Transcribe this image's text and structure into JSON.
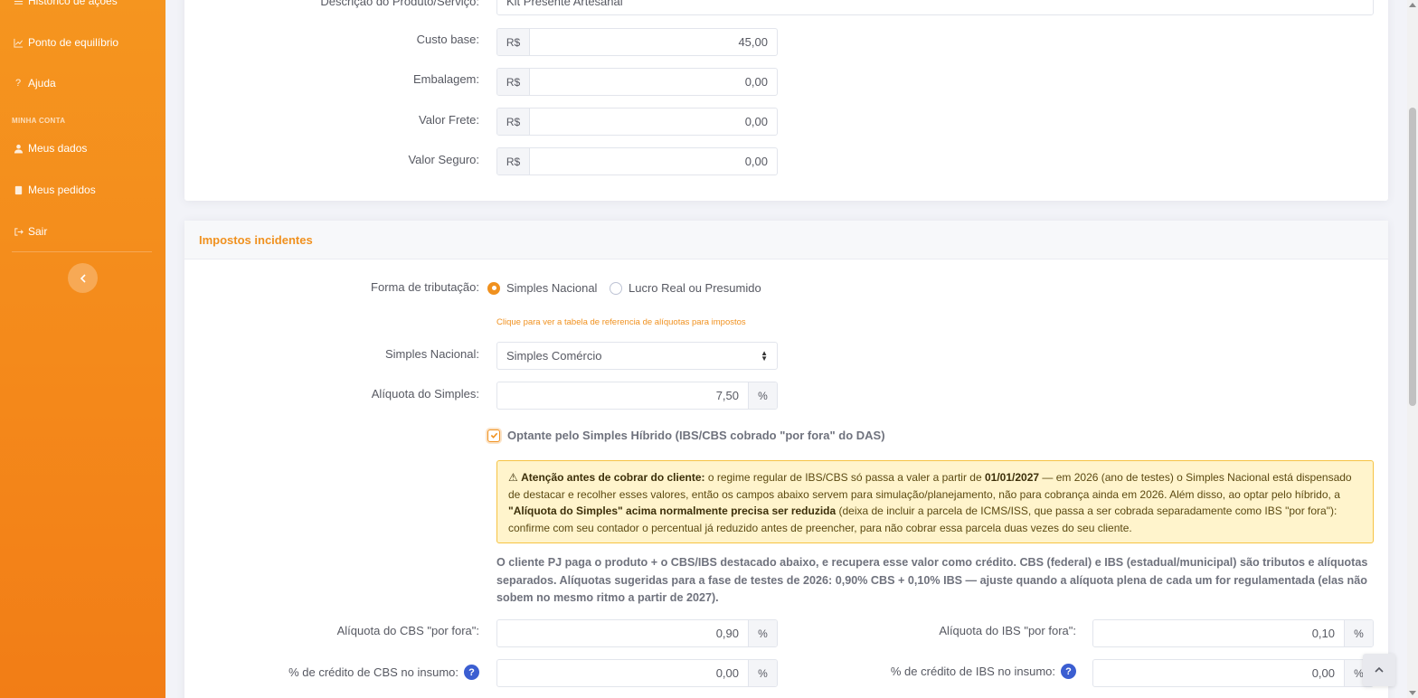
{
  "sidebar": {
    "items": [
      {
        "label": "Histórico de ações",
        "icon": "list-icon"
      },
      {
        "label": "Ponto de equilíbrio",
        "icon": "chart-line-icon"
      },
      {
        "label": "Ajuda",
        "icon": "question-icon"
      }
    ],
    "section_account": "MINHA CONTA",
    "account_items": [
      {
        "label": "Meus dados",
        "icon": "user-icon"
      },
      {
        "label": "Meus pedidos",
        "icon": "document-icon"
      },
      {
        "label": "Sair",
        "icon": "logout-icon"
      }
    ]
  },
  "product": {
    "desc_label": "Descrição do Produto/Serviço:",
    "desc_value": "Kit Presente Artesanal",
    "currency": "R$",
    "fields": [
      {
        "label": "Custo base:",
        "value": "45,00"
      },
      {
        "label": "Embalagem:",
        "value": "0,00"
      },
      {
        "label": "Valor Frete:",
        "value": "0,00"
      },
      {
        "label": "Valor Seguro:",
        "value": "0,00"
      }
    ]
  },
  "taxes": {
    "title": "Impostos incidentes",
    "tributacao_label": "Forma de tributação:",
    "option_simples": "Simples Nacional",
    "option_lucro": "Lucro Real ou Presumido",
    "reference_link": "Clique para ver a tabela de referencia de alíquotas para impostos",
    "simples_label": "Simples Nacional:",
    "simples_value": "Simples Comércio",
    "aliquota_label": "Alíquota do Simples:",
    "aliquota_value": "7,50",
    "percent": "%",
    "hibrido_label": "Optante pelo Simples Híbrido (IBS/CBS cobrado \"por fora\" do DAS)",
    "alert": {
      "strong1": "Atenção antes de cobrar do cliente:",
      "text1": " o regime regular de IBS/CBS só passa a valer a partir de ",
      "strong2": "01/01/2027",
      "text2": " — em 2026 (ano de testes) o Simples Nacional está dispensado de destacar e recolher esses valores, então os campos abaixo servem para simulação/planejamento, não para cobrança ainda em 2026. Além disso, ao optar pelo híbrido, a ",
      "strong3": "\"Alíquota do Simples\" acima normalmente precisa ser reduzida",
      "text3": " (deixa de incluir a parcela de ICMS/ISS, que passa a ser cobrada separadamente como IBS \"por fora\"): confirme com seu contador o percentual já reduzido antes de preencher, para não cobrar essa parcela duas vezes do seu cliente."
    },
    "info": "O cliente PJ paga o produto + o CBS/IBS destacado abaixo, e recupera esse valor como crédito. CBS (federal) e IBS (estadual/municipal) são tributos e alíquotas separados. Alíquotas sugeridas para a fase de testes de 2026: 0,90% CBS + 0,10% IBS — ajuste quando a alíquota plena de cada um for regulamentada (elas não sobem no mesmo ritmo a partir de 2027).",
    "cbs_label": "Alíquota do CBS \"por fora\":",
    "cbs_value": "0,90",
    "ibs_label": "Alíquota do IBS \"por fora\":",
    "ibs_value": "0,10",
    "credito_cbs_label": "% de crédito de CBS no insumo:",
    "credito_cbs_value": "0,00",
    "credito_ibs_label": "% de crédito de IBS no insumo:",
    "credito_ibs_value": "0,00",
    "help": "?"
  },
  "colors": {
    "accent": "#f0911f",
    "sidebar": "#f48a1b",
    "alert_bg": "#fff4cc",
    "help": "#3b5ed1"
  }
}
